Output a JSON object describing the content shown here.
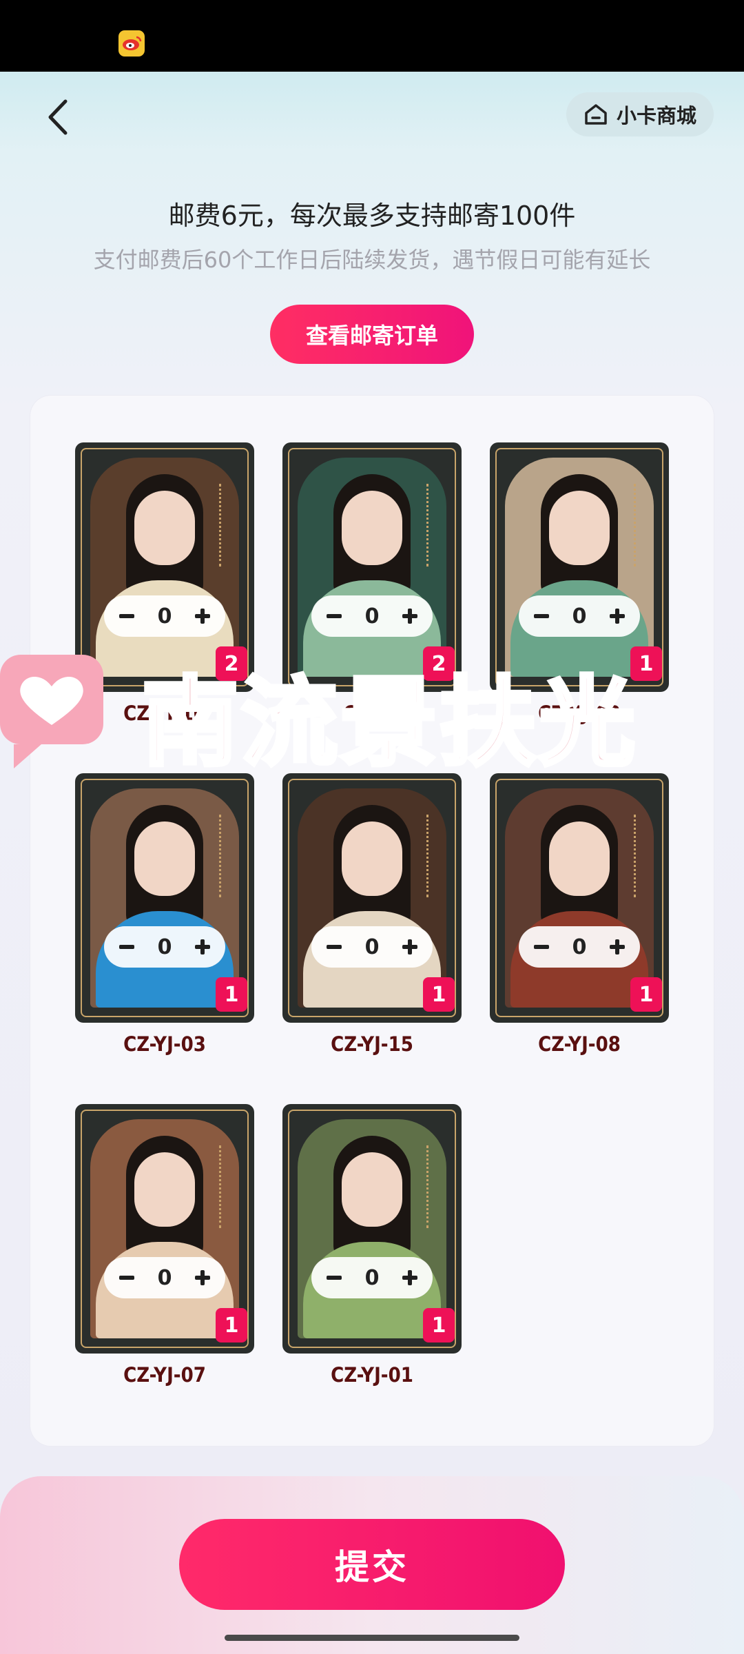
{
  "header": {
    "shop_label": "小卡商城"
  },
  "info": {
    "title": "邮费6元，每次最多支持邮寄100件",
    "subtitle": "支付邮费后60个工作日后陆续发货，遇节假日可能有延长",
    "orders_button": "查看邮寄订单"
  },
  "cards": [
    {
      "code": "CZ-YJ-10",
      "qty": "0",
      "count": "2",
      "robe": "#e9dcbf",
      "bg": "#5a3e2c",
      "code_hidden": true
    },
    {
      "code": "CZ-YJ-",
      "qty": "0",
      "count": "2",
      "robe": "#8bb99a",
      "bg": "#2f5347",
      "code_hidden": true
    },
    {
      "code": "CZ-YJ-02",
      "qty": "0",
      "count": "1",
      "robe": "#6aa58a",
      "bg": "#b9a48a",
      "code_hidden": true
    },
    {
      "code": "CZ-YJ-03",
      "qty": "0",
      "count": "1",
      "robe": "#2a8fd0",
      "bg": "#7a5a46"
    },
    {
      "code": "CZ-YJ-15",
      "qty": "0",
      "count": "1",
      "robe": "#e4d6c2",
      "bg": "#4b3326"
    },
    {
      "code": "CZ-YJ-08",
      "qty": "0",
      "count": "1",
      "robe": "#8e3a2a",
      "bg": "#5e3c30"
    },
    {
      "code": "CZ-YJ-07",
      "qty": "0",
      "count": "1",
      "robe": "#e6cbb0",
      "bg": "#8a5a40"
    },
    {
      "code": "CZ-YJ-01",
      "qty": "0",
      "count": "1",
      "robe": "#8fb06a",
      "bg": "#5f7048"
    }
  ],
  "watermark": {
    "text": "南流景扶光"
  },
  "submit": {
    "label": "提交"
  },
  "colors": {
    "accent": "#f0137a",
    "badge": "#ee1157",
    "code_text": "#5a1010"
  }
}
